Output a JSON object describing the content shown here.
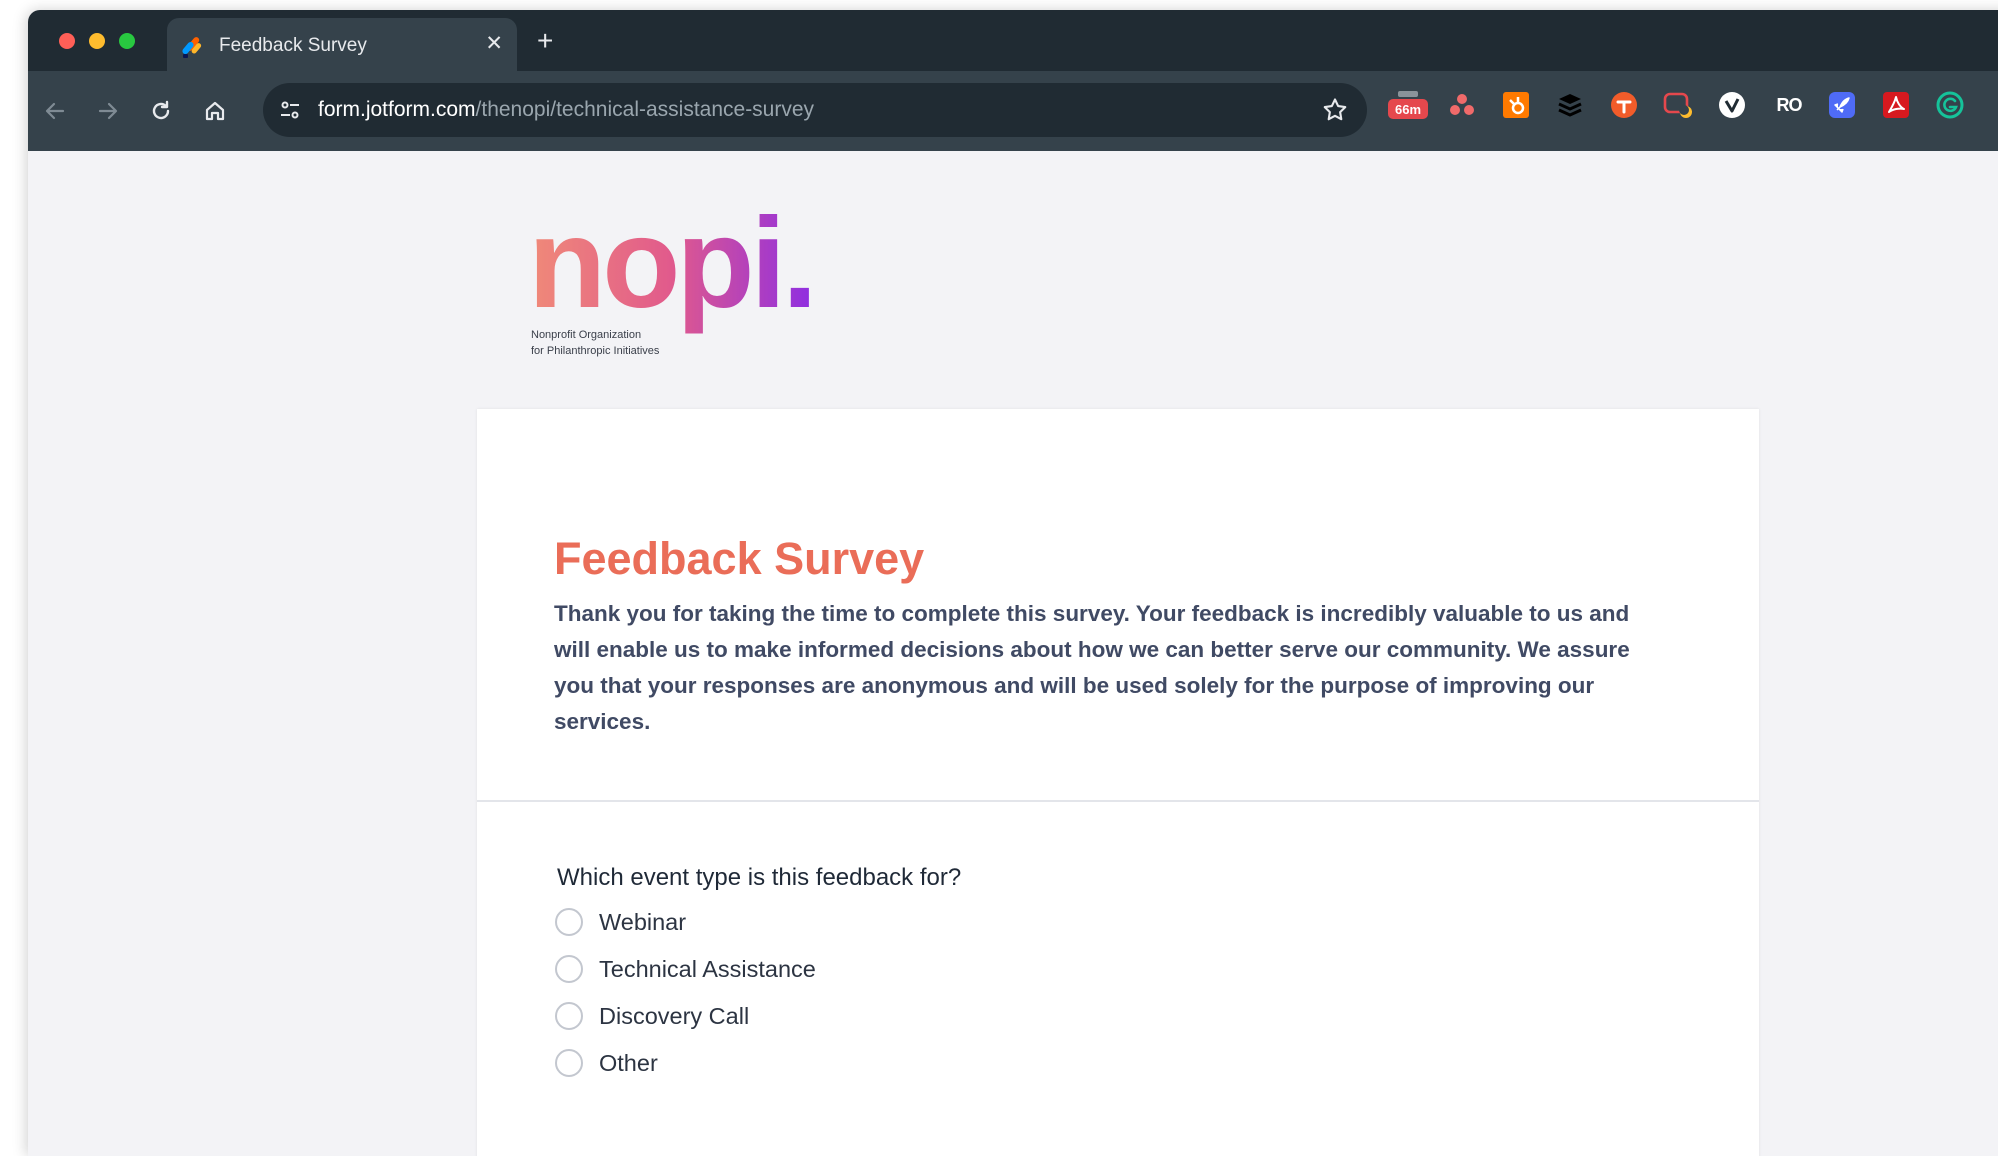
{
  "browser": {
    "tab": {
      "title": "Feedback Survey",
      "close_glyph": "✕",
      "favicon": "jotform-pencil-icon"
    },
    "new_tab_glyph": "+",
    "url": {
      "host": "form.jotform.com",
      "path": "/thenopi/technical-assistance-survey"
    },
    "extensions": [
      {
        "name": "timer-extension-icon",
        "badge": "66m",
        "color": "#e5484d"
      },
      {
        "name": "asana-extension-icon",
        "color": "#f06a6a"
      },
      {
        "name": "hubspot-extension-icon",
        "color": "#ff7a00"
      },
      {
        "name": "buffer-extension-icon",
        "color": "#000000"
      },
      {
        "name": "todoist-extension-icon",
        "color": "#f25c2a"
      },
      {
        "name": "screen-recorder-extension-icon",
        "color": "#e5484d"
      },
      {
        "name": "vimeo-extension-icon",
        "color": "#ffffff"
      },
      {
        "name": "ro-extension-icon",
        "label": "RO",
        "color": "#ffffff"
      },
      {
        "name": "rocket-extension-icon",
        "color": "#4f6bf6"
      },
      {
        "name": "acrobat-extension-icon",
        "color": "#d7191f"
      },
      {
        "name": "grammarly-extension-icon",
        "color": "#15c39a"
      }
    ]
  },
  "logo": {
    "wordmark": "nopi.",
    "tagline_line1": "Nonprofit Organization",
    "tagline_line2": "for Philanthropic Initiatives"
  },
  "form": {
    "title": "Feedback Survey",
    "description": "Thank you for taking the time to complete this survey. Your feedback is incredibly valuable to us and will enable us to make informed decisions about how we can better serve our community. We assure you that your responses are anonymous and will be used solely for the purpose of improving our services.",
    "question": "Which event type is this feedback for?",
    "options": [
      "Webinar",
      "Technical Assistance",
      "Discovery Call",
      "Other"
    ]
  },
  "colors": {
    "title_accent": "#ea6d58",
    "description_text": "#404a64",
    "tab_bar": "#202b33",
    "toolbar": "#35424b",
    "page_background": "#f3f3f6",
    "logo_gradient_start": "#f08a78",
    "logo_gradient_end": "#8e2de2"
  }
}
